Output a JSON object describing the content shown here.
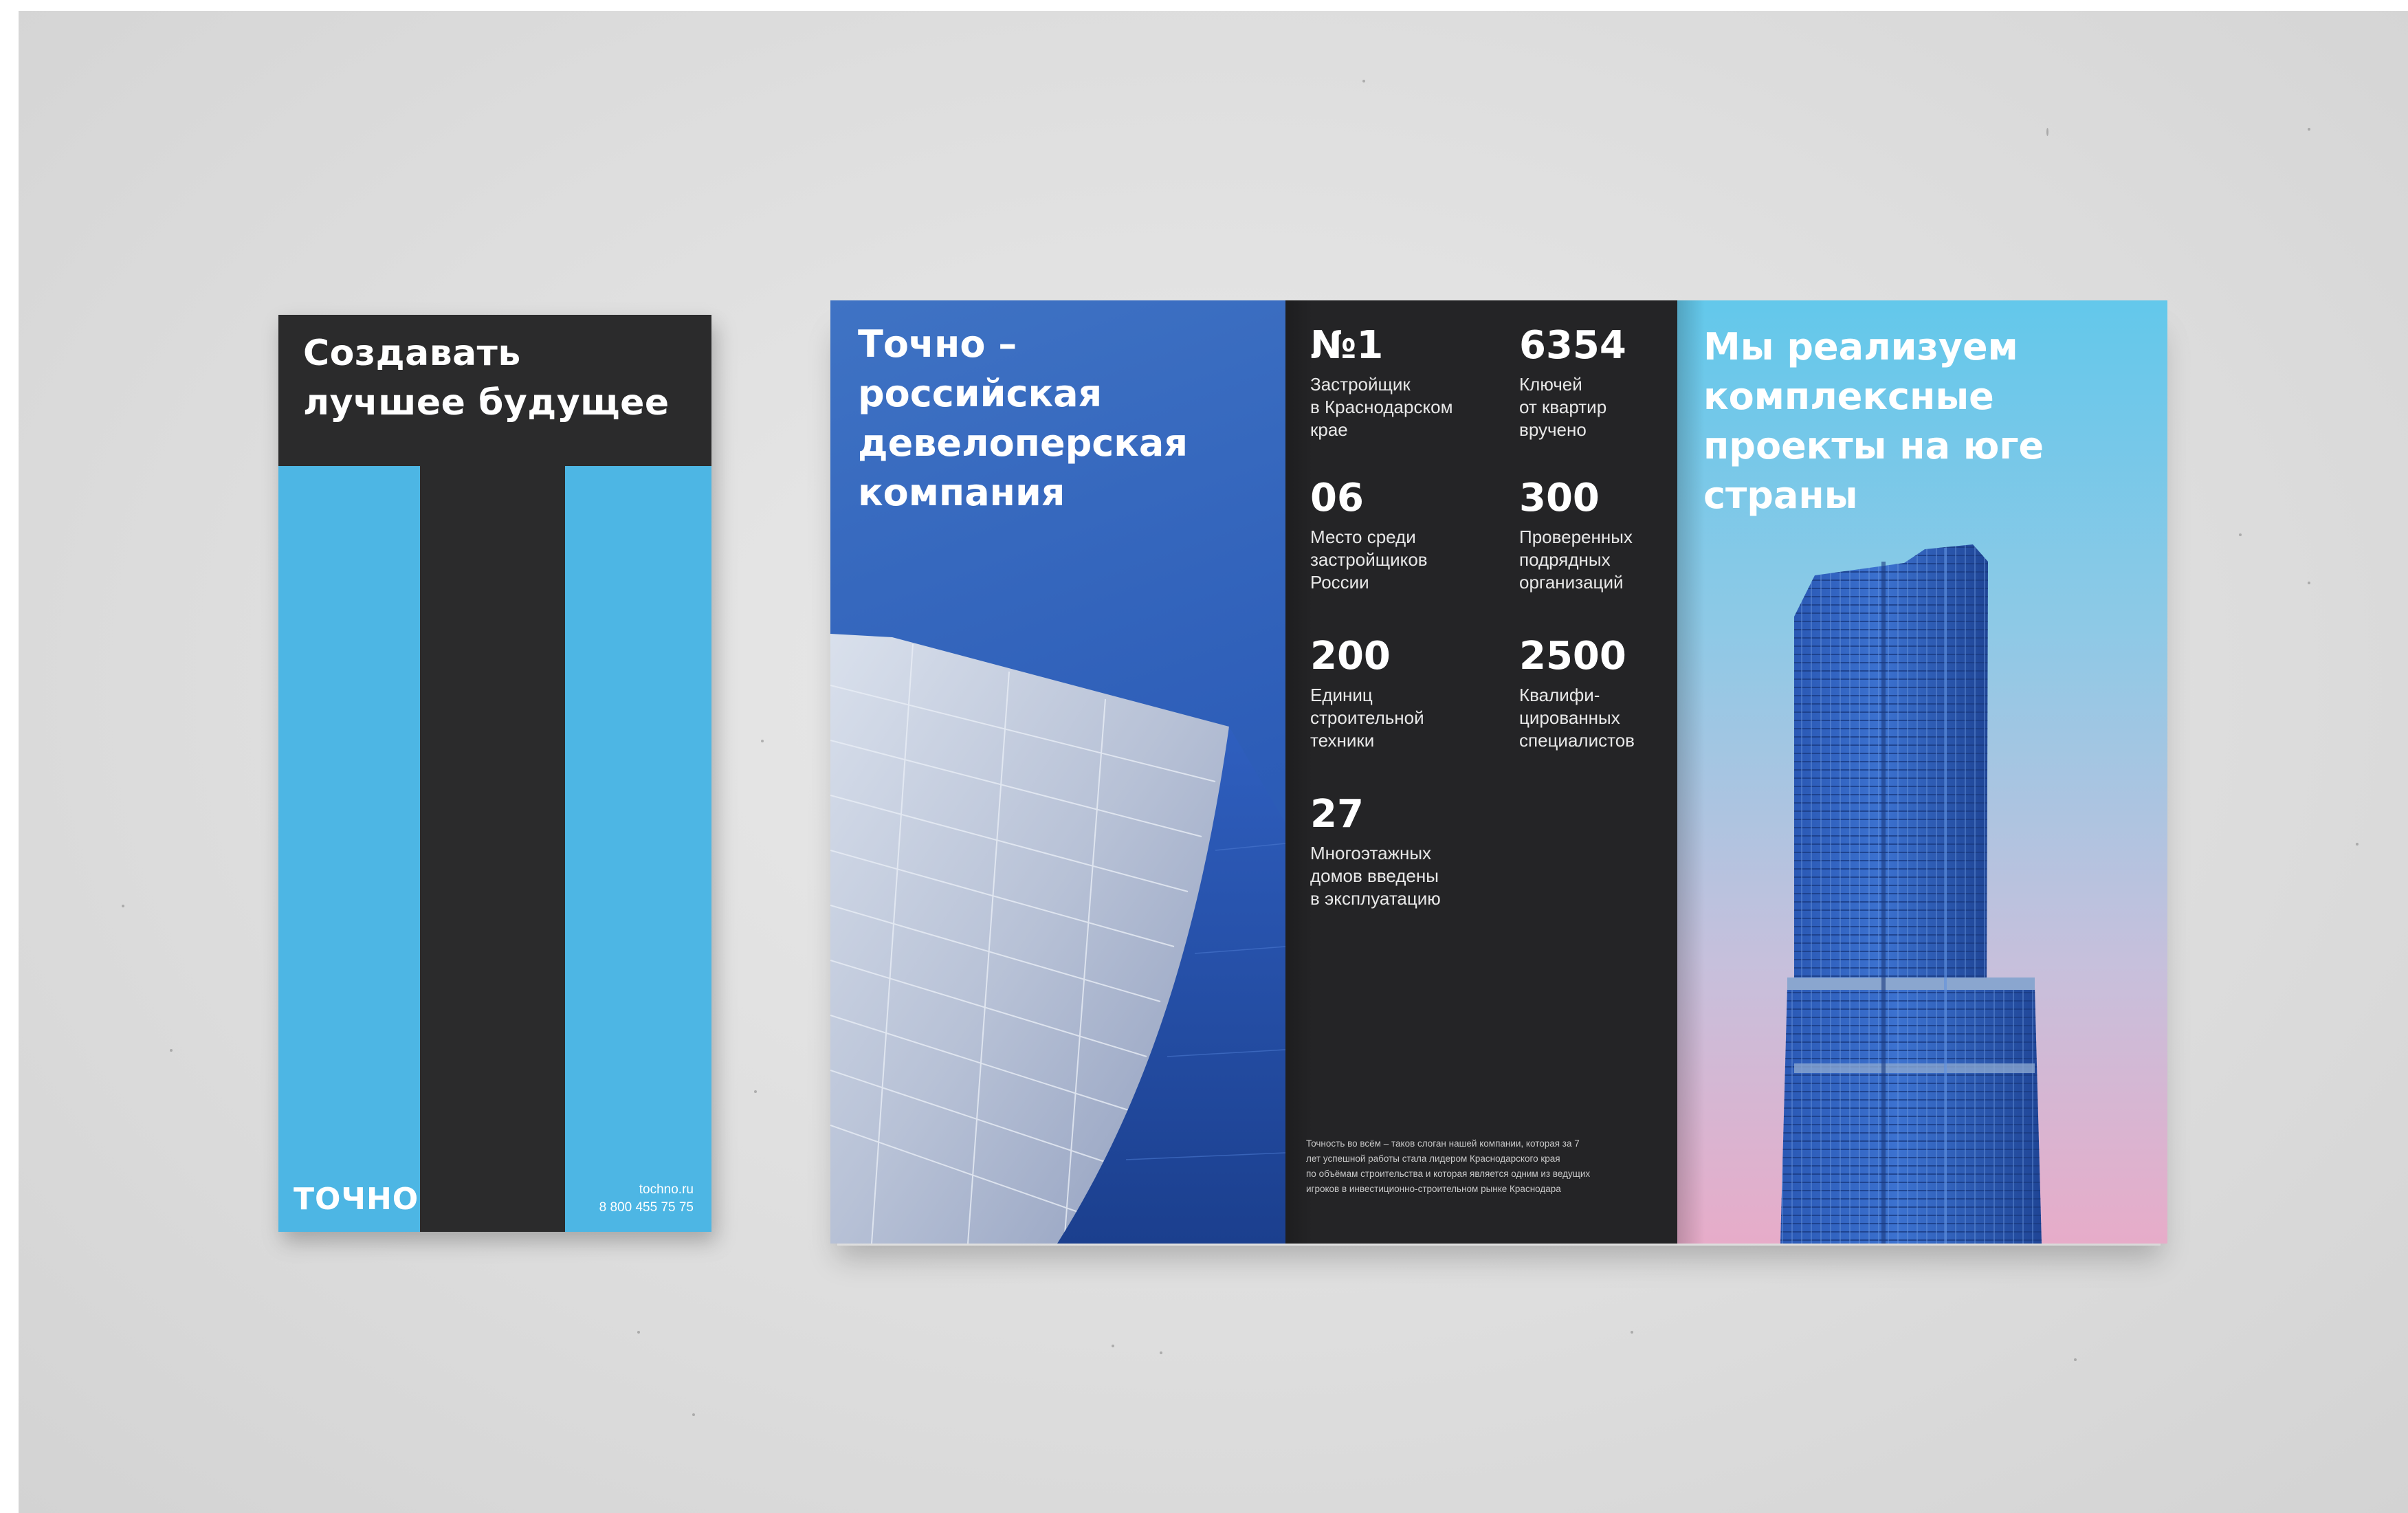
{
  "cover": {
    "title_line1": "Создавать",
    "title_line2": "лучшее будущее",
    "logo_text": "ТОЧНО",
    "website": "tochno.ru",
    "phone": "8 800 455 75 75",
    "colors": {
      "dark": "#2b2b2c",
      "blue": "#4db6e4"
    }
  },
  "brochure": {
    "panel1": {
      "title_lines": [
        "Точно –",
        "российская",
        "девелоперская",
        "компания"
      ]
    },
    "panel2": {
      "stats": [
        {
          "number": "№1",
          "label_lines": [
            "Застройщик",
            "в Краснодарском",
            "крае"
          ]
        },
        {
          "number": "6354",
          "label_lines": [
            "Ключей",
            "от квартир",
            "вручено"
          ]
        },
        {
          "number": "06",
          "label_lines": [
            "Место среди",
            "застройщиков",
            "России"
          ]
        },
        {
          "number": "300",
          "label_lines": [
            "Проверенных",
            "подрядных",
            "организаций"
          ]
        },
        {
          "number": "200",
          "label_lines": [
            "Единиц",
            "строительной",
            "техники"
          ]
        },
        {
          "number": "2500",
          "label_lines": [
            "Квалифи-",
            "цированных",
            "специалистов"
          ]
        },
        {
          "number": "27",
          "label_lines": [
            "Многоэтажных",
            "домов введены",
            "в эксплуатацию"
          ]
        }
      ],
      "about_lines": [
        "Точность во всём – таков слоган нашей компании, которая за 7",
        "лет успешной работы стала лидером Краснодарского края",
        "по объёмам строительства и которая является одним из ведущих",
        "игроков в инвестиционно-строительном рынке Краснодара"
      ]
    },
    "panel3": {
      "title_lines": [
        "Мы реализуем",
        "комплексные",
        "проекты на юге",
        "страны"
      ]
    }
  }
}
